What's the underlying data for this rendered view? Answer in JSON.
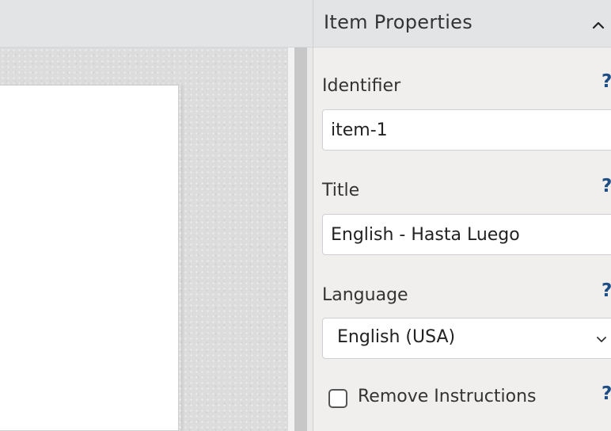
{
  "panel": {
    "title": "Item Properties",
    "collapse_icon": "chevron-up-icon"
  },
  "fields": {
    "identifier": {
      "label": "Identifier",
      "value": "item-1",
      "help": "?"
    },
    "title": {
      "label": "Title",
      "value": "English - Hasta Luego",
      "help": "?"
    },
    "language": {
      "label": "Language",
      "value": "English (USA)",
      "help": "?",
      "icon": "chevron-down-icon"
    },
    "remove_instructions": {
      "label": "Remove Instructions",
      "checked": false,
      "help": "?"
    }
  },
  "colors": {
    "help_icon": "#1f4e84",
    "panel_bg": "#f0efee",
    "header_bg": "#e3e4e6"
  }
}
